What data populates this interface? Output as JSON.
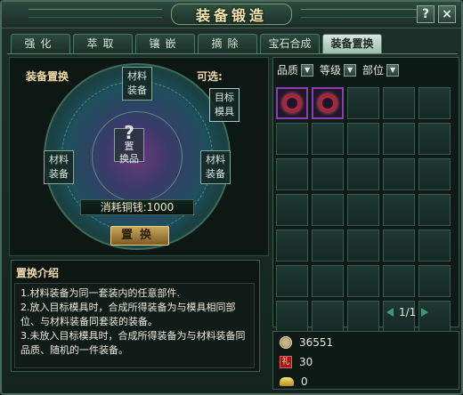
{
  "window": {
    "title": "装备锻造",
    "help_label": "?",
    "close_label": "×"
  },
  "tabs": [
    {
      "label": "强化"
    },
    {
      "label": "萃取"
    },
    {
      "label": "镶嵌"
    },
    {
      "label": "摘除"
    },
    {
      "label": "宝石合成"
    },
    {
      "label": "装备置换",
      "active": true
    }
  ],
  "swap_panel": {
    "heading": "装备置换",
    "optional_label": "可选:",
    "slot_top": "材料装备",
    "slot_left": "材料装备",
    "slot_right": "材料装备",
    "slot_target": "目标模具",
    "center_line1": "?",
    "center_line2": "置",
    "center_line3": "换品",
    "cost_label": "消耗铜钱:1000",
    "swap_button": "置换"
  },
  "intro": {
    "title": "置换介绍",
    "lines": [
      "1.材料装备为同一套装内的任意部件.",
      "2.放入目标模具时，合成所得装备为与模具相同部位、与材料装备同套装的装备。",
      "3.未放入目标模具时，合成所得装备为与材料装备同品质、随机的一件装备。"
    ]
  },
  "inventory": {
    "filters": [
      {
        "label": "品质"
      },
      {
        "label": "等级"
      },
      {
        "label": "部位"
      }
    ],
    "page_indicator": "1/1",
    "item_count": 2
  },
  "wallet": {
    "copper": "36551",
    "gift": "30",
    "gold": "0",
    "gift_icon_label": "礼"
  },
  "colors": {
    "accent": "#f2d9a8",
    "item_border": "#8c3fb0",
    "button": "#c9a85a"
  }
}
